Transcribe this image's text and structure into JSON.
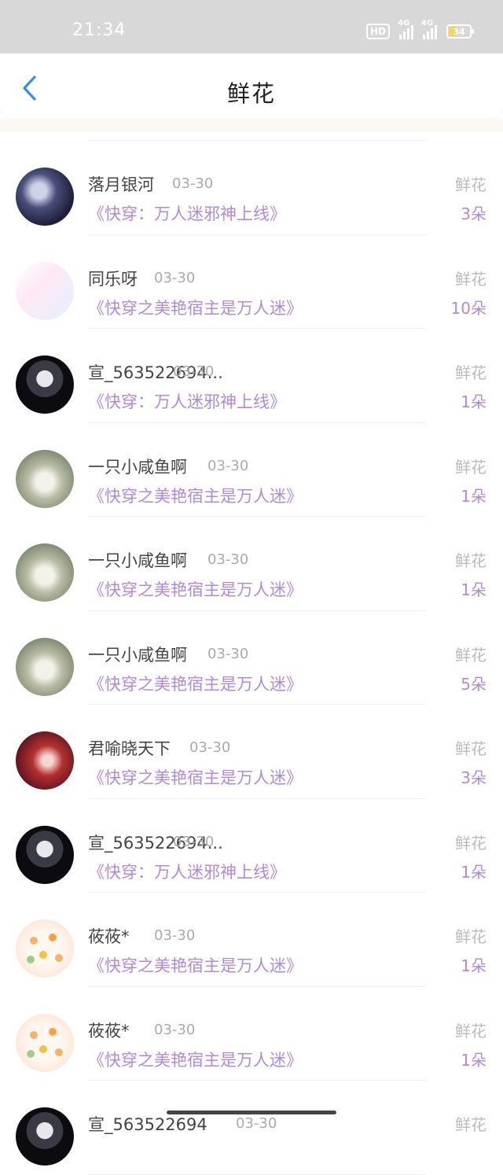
{
  "status_bar": {
    "time": "21:34",
    "hd": "HD",
    "net1": "4G",
    "net2": "4G",
    "battery": "34"
  },
  "header": {
    "title": "鲜花"
  },
  "list": [
    {
      "user": "落月银河",
      "date": "03-30",
      "book": "《快穿：万人迷邪神上线》",
      "label": "鲜花",
      "count": "3朵",
      "avatar": "moon"
    },
    {
      "user": "同乐呀",
      "date": "03-30",
      "book": "《快穿之美艳宿主是万人迷》",
      "label": "鲜花",
      "count": "10朵",
      "avatar": "calli"
    },
    {
      "user": "宣_563522694...",
      "date": "03-30",
      "book": "《快穿：万人迷邪神上线》",
      "label": "鲜花",
      "count": "1朵",
      "avatar": "dark"
    },
    {
      "user": "一只小咸鱼啊",
      "date": "03-30",
      "book": "《快穿之美艳宿主是万人迷》",
      "label": "鲜花",
      "count": "1朵",
      "avatar": "umbrella"
    },
    {
      "user": "一只小咸鱼啊",
      "date": "03-30",
      "book": "《快穿之美艳宿主是万人迷》",
      "label": "鲜花",
      "count": "1朵",
      "avatar": "umbrella"
    },
    {
      "user": "一只小咸鱼啊",
      "date": "03-30",
      "book": "《快穿之美艳宿主是万人迷》",
      "label": "鲜花",
      "count": "5朵",
      "avatar": "umbrella"
    },
    {
      "user": "君喻晓天下",
      "date": "03-30",
      "book": "《快穿之美艳宿主是万人迷》",
      "label": "鲜花",
      "count": "3朵",
      "avatar": "red"
    },
    {
      "user": "宣_563522694...",
      "date": "03-30",
      "book": "《快穿：万人迷邪神上线》",
      "label": "鲜花",
      "count": "1朵",
      "avatar": "dark"
    },
    {
      "user": "莜莜*",
      "date": "03-30",
      "book": "《快穿之美艳宿主是万人迷》",
      "label": "鲜花",
      "count": "1朵",
      "avatar": "soft"
    },
    {
      "user": "莜莜*",
      "date": "03-30",
      "book": "《快穿之美艳宿主是万人迷》",
      "label": "鲜花",
      "count": "1朵",
      "avatar": "soft"
    },
    {
      "user": "宣_563522694",
      "date": "03-30",
      "book": "",
      "label": "鲜花",
      "count": "",
      "avatar": "dark"
    }
  ],
  "colors": {
    "accent_purple": "#b08ad8",
    "back_arrow": "#3a8ee6",
    "status_bar_bg": "#d8d8d8"
  }
}
